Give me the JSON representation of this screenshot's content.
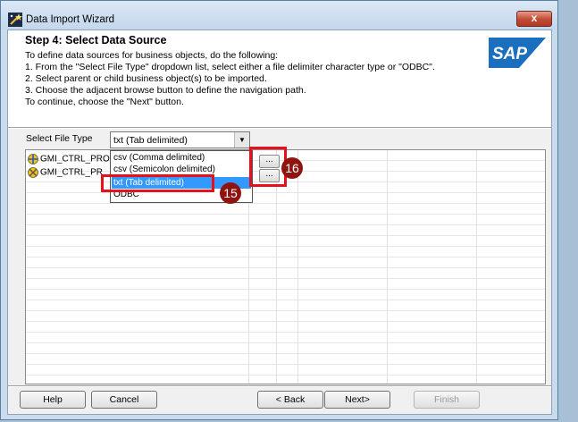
{
  "window": {
    "title": "Data Import Wizard",
    "close_label": "x"
  },
  "header": {
    "step_title": "Step 4: Select Data Source",
    "instructions": [
      "To define data sources for business objects, do the following:",
      "1. From the \"Select File Type\" dropdown list, select either a file delimiter character type or \"ODBC\".",
      "2. Select parent or child business object(s) to be imported.",
      "3. Choose the adjacent browse button to define the navigation path.",
      "To continue, choose the \"Next\" button."
    ],
    "logo_text": "SAP"
  },
  "file_type": {
    "label": "Select File Type",
    "selected": "txt (Tab delimited)",
    "options": [
      "csv (Comma delimited)",
      "csv (Semicolon delimited)",
      "txt (Tab delimited)",
      "ODBC"
    ]
  },
  "objects": [
    {
      "name": "GMI_CTRL_PRO",
      "browse": "..."
    },
    {
      "name": "GMI_CTRL_PR",
      "browse": "..."
    }
  ],
  "annotations": {
    "badge_1": "16",
    "badge_2": "15"
  },
  "buttons": {
    "help": "Help",
    "cancel": "Cancel",
    "back": "< Back",
    "next": "Next>",
    "finish": "Finish"
  },
  "colors": {
    "highlight": "#e8101a",
    "badge": "#8e1410",
    "selection": "#3399ff",
    "logo_blue": "#1c6fbf"
  }
}
